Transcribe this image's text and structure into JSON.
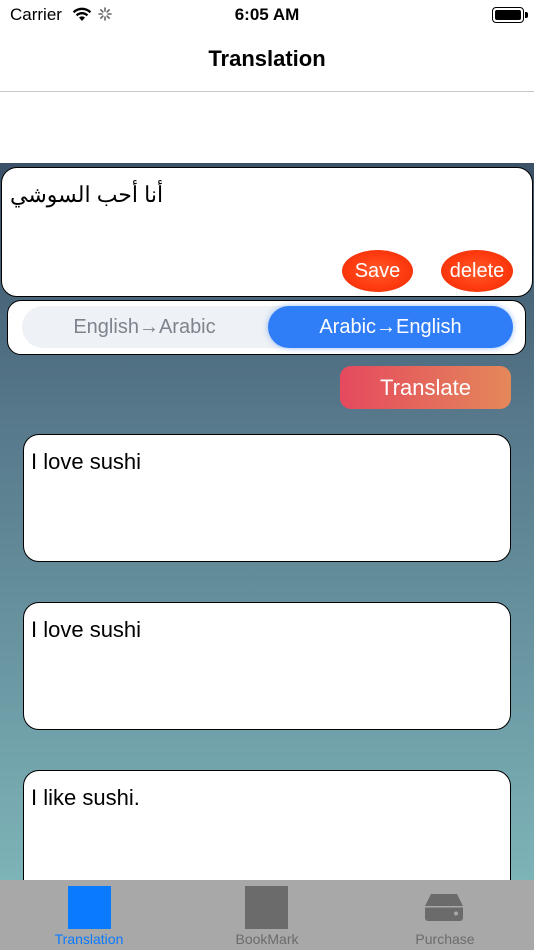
{
  "status": {
    "carrier": "Carrier",
    "time": "6:05 AM"
  },
  "nav": {
    "title": "Translation"
  },
  "input": {
    "text": "أنا أحب السوشي",
    "save_label": "Save",
    "delete_label": "delete"
  },
  "segment": {
    "left_label": "English→Arabic",
    "right_label": "Arabic→English",
    "selected": "Arabic→English"
  },
  "translate": {
    "label": "Translate"
  },
  "results": [
    {
      "text": "I love sushi"
    },
    {
      "text": "I love sushi"
    },
    {
      "text": "I like sushi."
    }
  ],
  "tabs": [
    {
      "label": "Translation",
      "active": true
    },
    {
      "label": "BookMark",
      "active": false
    },
    {
      "label": "Purchase",
      "active": false
    }
  ],
  "colors": {
    "accent": "#0a7bff",
    "delete_save": "#ff3b10",
    "segment_selected": "#2f7df7"
  }
}
